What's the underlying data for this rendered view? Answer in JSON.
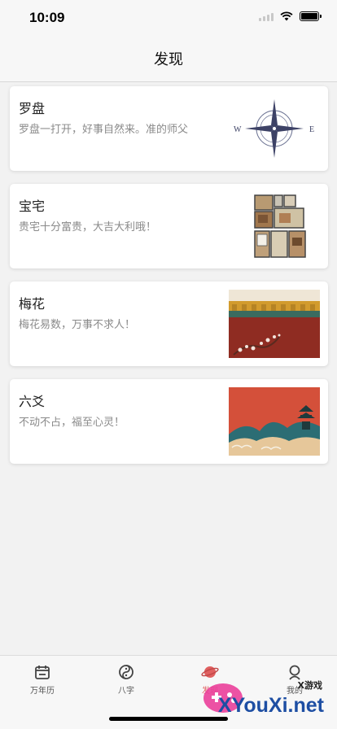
{
  "status_bar": {
    "time": "10:09"
  },
  "nav": {
    "title": "发现"
  },
  "cards": [
    {
      "title": "罗盘",
      "desc": "罗盘一打开，好事自然来。准的师父",
      "compass_w": "W",
      "compass_e": "E"
    },
    {
      "title": "宝宅",
      "desc": "贵宅十分富贵，大吉大利哦！"
    },
    {
      "title": "梅花",
      "desc": "梅花易数，万事不求人！"
    },
    {
      "title": "六爻",
      "desc": "不动不占，福至心灵！"
    }
  ],
  "tabs": [
    {
      "label": "万年历",
      "icon": "calendar-icon"
    },
    {
      "label": "八字",
      "icon": "yin-yang-icon"
    },
    {
      "label": "发现",
      "icon": "planet-icon",
      "active": true
    },
    {
      "label": "我的",
      "icon": "profile-icon"
    }
  ],
  "watermark": {
    "brand": "XYouXi.net",
    "tagline": "X游戏"
  },
  "colors": {
    "active_tab": "#e06060",
    "desc_text": "#8a8a8a",
    "watermark": "#1d4ea3"
  }
}
